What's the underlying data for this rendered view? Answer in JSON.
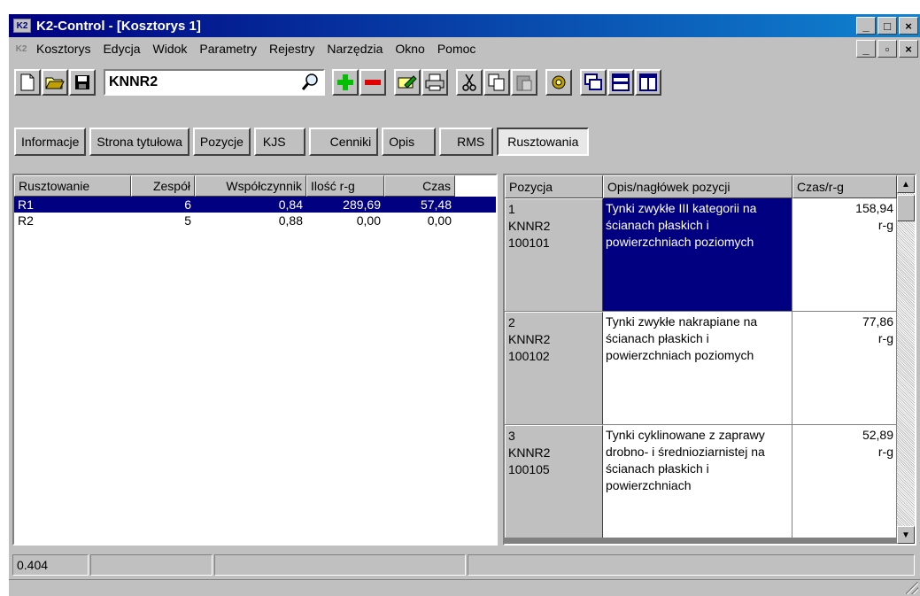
{
  "window": {
    "app_icon": "K2",
    "title": "K2-Control - [Kosztorys 1]",
    "controls": [
      "_",
      "□",
      "×"
    ]
  },
  "menubar": {
    "icon": "K2",
    "items": [
      "Kosztorys",
      "Edycja",
      "Widok",
      "Parametry",
      "Rejestry",
      "Narzędzia",
      "Okno",
      "Pomoc"
    ],
    "mdi_controls": [
      "_",
      "▫",
      "×"
    ]
  },
  "toolbar": {
    "search_value": "KNNR2",
    "icons": [
      "new-document-icon",
      "open-folder-icon",
      "save-disk-icon",
      "search-icon",
      "add-plus-icon",
      "remove-minus-icon",
      "edit-icon",
      "print-icon",
      "cut-icon",
      "copy-icon",
      "paste-icon",
      "settings-gear-icon",
      "window-cascade-icon",
      "window-horizontal-icon",
      "window-vertical-icon"
    ]
  },
  "tabs": [
    "Informacje",
    "Strona tytułowa",
    "Pozycje",
    "KJS",
    "Cenniki",
    "Opis",
    "RMS",
    "Rusztowania"
  ],
  "active_tab": "Rusztowania",
  "left_table": {
    "columns": [
      "Rusztowanie",
      "Zespół",
      "Współczynnik",
      "Ilość r-g",
      "Czas"
    ],
    "rows": [
      {
        "name": "R1",
        "zespol": "6",
        "wsp": "0,84",
        "ilosc": "289,69",
        "czas": "57,48",
        "selected": true
      },
      {
        "name": "R2",
        "zespol": "5",
        "wsp": "0,88",
        "ilosc": "0,00",
        "czas": "0,00",
        "selected": false
      }
    ]
  },
  "right_table": {
    "columns": [
      "Pozycja",
      "Opis/nagłówek pozycji",
      "Czas/r-g"
    ],
    "rows": [
      {
        "nr": "1",
        "kod": "KNNR2",
        "numer": "100101",
        "opis": "Tynki zwykłe III kategorii na ścianach płaskich i powierzchniach poziomych",
        "czas": "158,94",
        "jedn": "r-g",
        "selected": true
      },
      {
        "nr": "2",
        "kod": "KNNR2",
        "numer": "100102",
        "opis": "Tynki zwykłe nakrapiane na ścianach płaskich i powierzchniach poziomych",
        "czas": "77,86",
        "jedn": "r-g",
        "selected": false
      },
      {
        "nr": "3",
        "kod": "KNNR2",
        "numer": "100105",
        "opis": "Tynki cyklinowane z zaprawy drobno- i średnioziarnistej na ścianach płaskich i powierzchniach",
        "czas": "52,89",
        "jedn": "r-g",
        "selected": false
      }
    ]
  },
  "statusbar": {
    "panels": [
      "0.404",
      "",
      "",
      ""
    ]
  },
  "colors": {
    "selection": "#000080",
    "face": "#c0c0c0",
    "title_gradient_start": "#000080",
    "title_gradient_end": "#1084d0"
  }
}
